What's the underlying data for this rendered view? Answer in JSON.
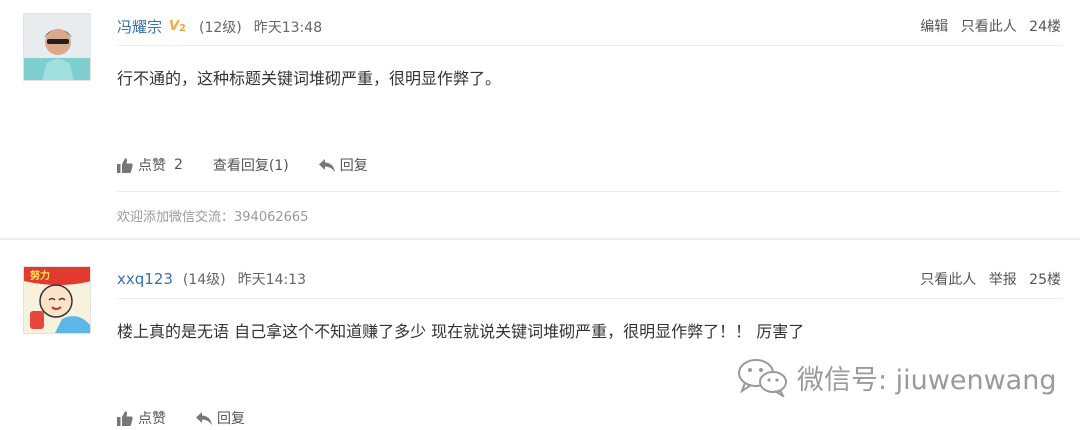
{
  "posts": [
    {
      "username": "冯耀宗",
      "vip_badge": "V2",
      "level": "(12级)",
      "time": "昨天13:48",
      "ops": [
        "编辑",
        "只看此人",
        "24楼"
      ],
      "content": "行不通的，这种标题关键词堆砌严重，很明显作弊了。",
      "like_label": "点赞",
      "like_count": "2",
      "view_replies": "查看回复(1)",
      "reply_label": "回复",
      "signature": "欢迎添加微信交流：394062665"
    },
    {
      "username": "xxq123",
      "level": "(14级)",
      "time": "昨天14:13",
      "ops": [
        "只看此人",
        "举报",
        "25楼"
      ],
      "content": "楼上真的是无语 自己拿这个不知道赚了多少 现在就说关键词堆砌严重，很明显作弊了！！ 厉害了",
      "like_label": "点赞",
      "reply_label": "回复"
    }
  ],
  "watermark": "微信号: jiuwenwang",
  "icons": [
    "thumb-up-icon",
    "reply-arrow-icon",
    "wechat-logo-icon"
  ],
  "colors": {
    "username": "#3a6fb0",
    "vip": "#f2a93b",
    "muted": "#999999"
  }
}
